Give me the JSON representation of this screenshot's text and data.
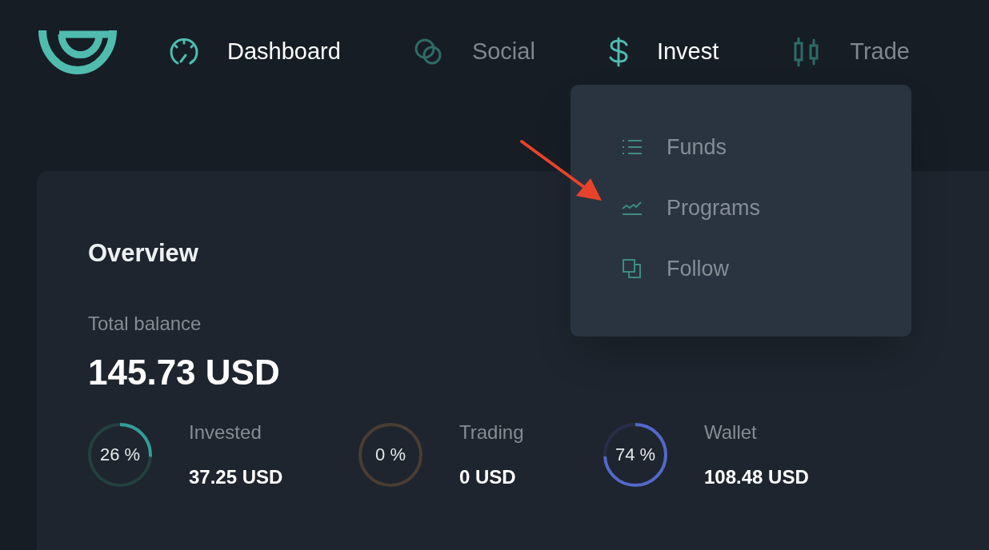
{
  "nav": [
    {
      "kind": "gauge",
      "label": "Dashboard",
      "highlighted": true
    },
    {
      "kind": "chat",
      "label": "Social",
      "highlighted": false
    },
    {
      "kind": "dollar",
      "label": "Invest",
      "highlighted": true
    },
    {
      "kind": "candles",
      "label": "Trade",
      "highlighted": false
    }
  ],
  "menu": {
    "items": [
      {
        "kind": "list",
        "label": "Funds"
      },
      {
        "kind": "chart",
        "label": "Programs"
      },
      {
        "kind": "copy",
        "label": "Follow"
      }
    ]
  },
  "overview": {
    "title": "Overview",
    "balance_label": "Total balance",
    "balance": "145.73 USD",
    "parts": [
      {
        "percent": "26 %",
        "label": "Invested",
        "amount": "37.25 USD",
        "level": 0.26,
        "color": "#24403f"
      },
      {
        "percent": "0 %",
        "label": "Trading",
        "amount": "0 USD",
        "level": 0,
        "color": "#4a3d33"
      },
      {
        "percent": "74 %",
        "label": "Wallet",
        "amount": "108.48 USD",
        "level": 0.74,
        "color": "#282e48"
      }
    ]
  }
}
